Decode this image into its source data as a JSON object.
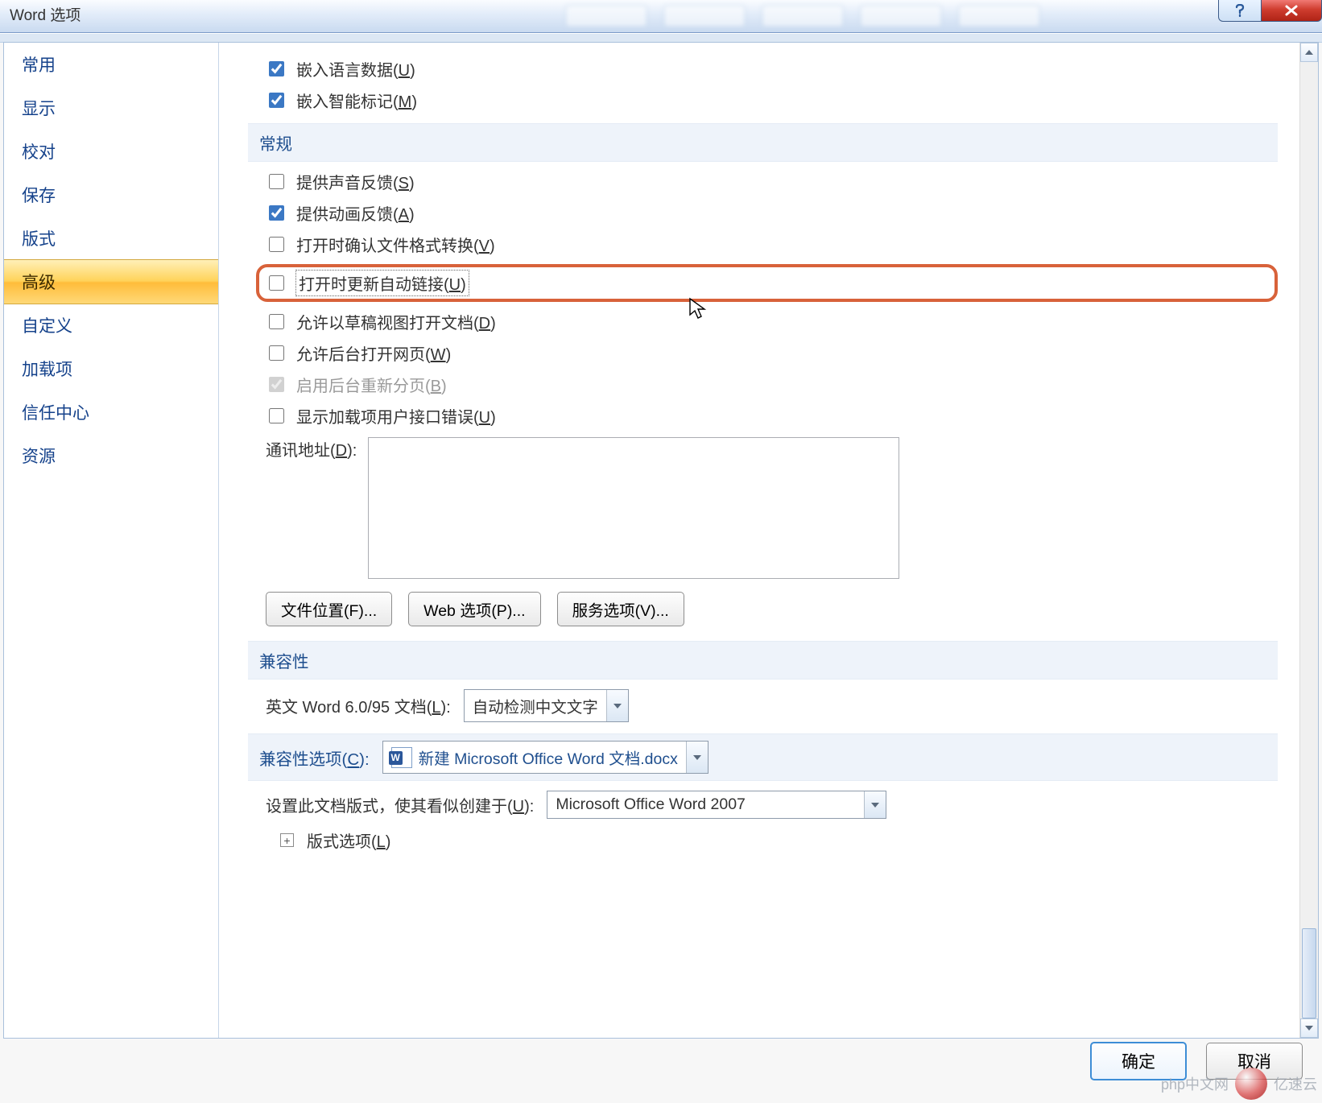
{
  "window": {
    "title": "Word 选项"
  },
  "categories": [
    {
      "label": "常用"
    },
    {
      "label": "显示"
    },
    {
      "label": "校对"
    },
    {
      "label": "保存"
    },
    {
      "label": "版式"
    },
    {
      "label": "高级",
      "selected": true
    },
    {
      "label": "自定义"
    },
    {
      "label": "加载项"
    },
    {
      "label": "信任中心"
    },
    {
      "label": "资源"
    }
  ],
  "top_checks": {
    "embed_lang": {
      "label": "嵌入语言数据(",
      "hotkey": "U",
      "tail": ")",
      "checked": true
    },
    "embed_smart": {
      "label": "嵌入智能标记(",
      "hotkey": "M",
      "tail": ")",
      "checked": true
    }
  },
  "sections": {
    "general_head": "常规",
    "compat_head": "兼容性",
    "compat_opt_head": "兼容性选项(",
    "compat_opt_hotkey": "C",
    "compat_opt_tail": "):"
  },
  "general_checks": {
    "sound": {
      "label": "提供声音反馈(",
      "hotkey": "S",
      "tail": ")",
      "checked": false
    },
    "anim": {
      "label": "提供动画反馈(",
      "hotkey": "A",
      "tail": ")",
      "checked": true
    },
    "confirm_conv": {
      "label": "打开时确认文件格式转换(",
      "hotkey": "V",
      "tail": ")",
      "checked": false
    },
    "update_links": {
      "label": "打开时更新自动链接(",
      "hotkey": "U",
      "tail": ")",
      "checked": false
    },
    "draft_view": {
      "label": "允许以草稿视图打开文档(",
      "hotkey": "D",
      "tail": ")",
      "checked": false
    },
    "bg_open_web": {
      "label": "允许后台打开网页(",
      "hotkey": "W",
      "tail": ")",
      "checked": false
    },
    "bg_repaginate": {
      "label": "启用后台重新分页(",
      "hotkey": "B",
      "tail": ")",
      "checked": true,
      "disabled": true
    },
    "addin_errors": {
      "label": "显示加载项用户接口错误(",
      "hotkey": "U",
      "tail": ")",
      "checked": false
    }
  },
  "address": {
    "label": "通讯地址(",
    "hotkey": "D",
    "tail": "):",
    "value": ""
  },
  "buttons": {
    "file_loc": "文件位置(F)...",
    "web_opt": "Web 选项(P)...",
    "svc_opt": "服务选项(V)..."
  },
  "compat": {
    "en_word_label": "英文 Word 6.0/95 文档(",
    "en_word_hotkey": "L",
    "en_word_tail": "):",
    "en_word_value": "自动检测中文文字",
    "doc_value": "新建 Microsoft Office Word 文档.docx",
    "layout_label": "设置此文档版式，使其看似创建于(",
    "layout_hotkey": "U",
    "layout_tail": "):",
    "layout_value": "Microsoft Office Word 2007",
    "layout_opts_label": "版式选项(",
    "layout_opts_hotkey": "L",
    "layout_opts_tail": ")"
  },
  "footer": {
    "ok": "确定",
    "cancel": "取消"
  },
  "watermark": {
    "site1": "php中文网",
    "site2": "亿速云"
  }
}
